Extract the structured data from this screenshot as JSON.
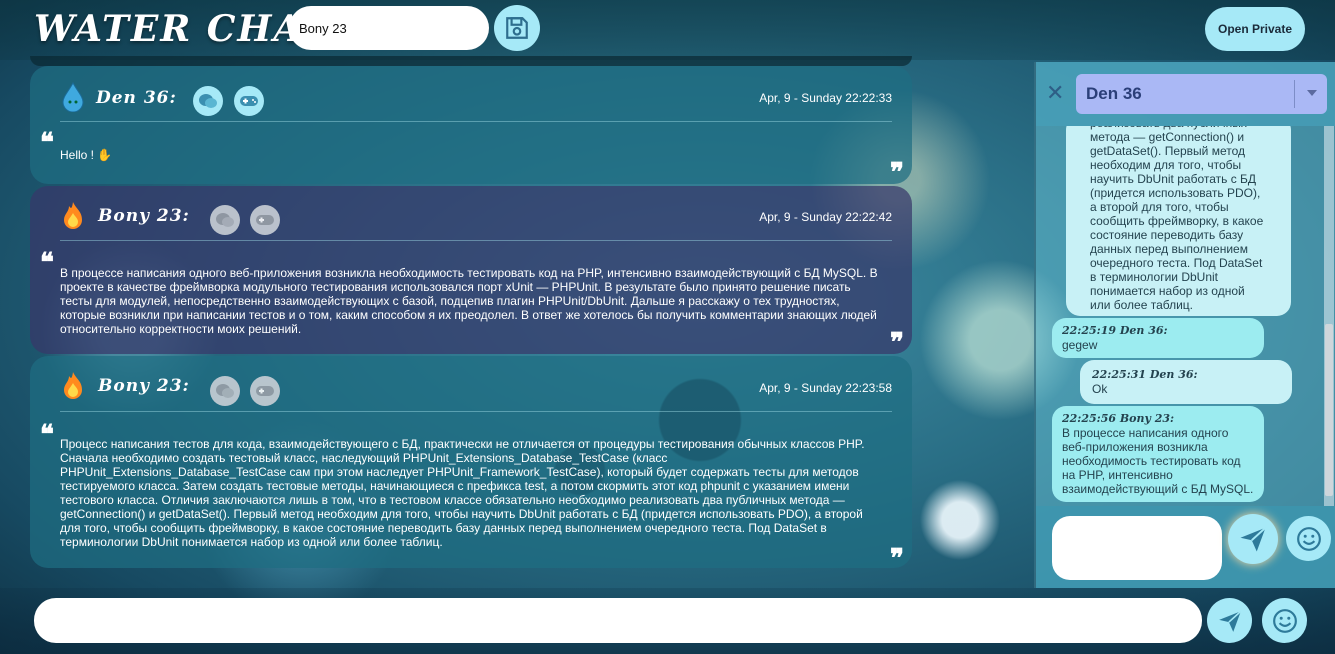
{
  "header": {
    "logo": "WATER CHAT",
    "name_value": "Bony 23",
    "open_private_label": "Open Private"
  },
  "messages": [
    {
      "author": "Den 36:",
      "date": "Apr, 9 - Sunday 22:22:33",
      "text": "Hello ! ✋"
    },
    {
      "author": "Bony 23:",
      "date": "Apr, 9 - Sunday 22:22:42",
      "text": "В процессе написания одного веб-приложения возникла необходимость тестировать код на PHP, интенсивно взаимодействующий с БД MySQL. В проекте в качестве фреймворка модульного тестирования использовался порт xUnit — PHPUnit. В результате было принято решение писать тесты для модулей, непосредственно взаимодействующих с базой, подцепив плагин PHPUnit/DbUnit. Дальше я расскажу о тех трудностях, которые возникли при написании тестов и о том, каким способом я их преодолел. В ответ же хотелось бы получить комментарии знающих людей относительно корректности моих решений."
    },
    {
      "author": "Bony 23:",
      "date": "Apr, 9 - Sunday 22:23:58",
      "text": "Процесс написания тестов для кода, взаимодействующего с БД, практически не отличается от процедуры тестирования обычных классов PHP. Сначала необходимо создать тестовый класс, наследующий PHPUnit_Extensions_Database_TestCase (класс PHPUnit_Extensions_Database_TestCase сам при этом наследует PHPUnit_Framework_TestCase), который будет содержать тесты для методов тестируемого класса. Затем создать тестовые методы, начинающиеся с префикса test, а потом скормить этот код phpunit с указанием имени тестового класса. Отличия заключаются лишь в том, что в тестовом классе обязательно необходимо реализовать два публичных метода — getConnection() и getDataSet(). Первый метод необходим для того, чтобы научить DbUnit работать с БД (придется использовать PDO), а второй для того, чтобы сообщить фреймворку, в какое состояние переводить базу данных перед выполнением очередного теста. Под DataSet в терминологии DbUnit понимается набор из одной или более таблиц."
    }
  ],
  "private": {
    "selected_user": "Den 36",
    "first_bubble_text": "реализовать два публичных метода — getConnection() и getDataSet(). Первый метод необходим для того, чтобы научить DbUnit работать с БД (придется использовать PDO), а второй для того, чтобы сообщить фреймворку, в какое состояние переводить базу данных перед выполнением очередного теста. Под DataSet в терминологии DbUnit понимается набор из одной или более таблиц.",
    "messages": [
      {
        "meta": "22:25:19 Den 36:",
        "text": "gegew"
      },
      {
        "meta": "22:25:31 Den 36:",
        "text": "Ok"
      },
      {
        "meta": "22:25:56 Bony 23:",
        "text": "В процессе написания одного веб-приложения возникла необходимость тестировать код на PHP, интенсивно взаимодействующий с БД MySQL."
      }
    ]
  },
  "colors": {
    "accent": "#a6e9f7",
    "select_bg": "#aab8f5",
    "msg_teal": "#1e6e82",
    "msg_purple": "#373769"
  },
  "icons": [
    "save-icon",
    "wechat-icon",
    "gamepad-icon",
    "quote-left-icon",
    "quote-right-icon",
    "send-icon",
    "smile-icon",
    "close-icon",
    "chevron-down-icon",
    "water-drop-icon",
    "fire-icon"
  ]
}
